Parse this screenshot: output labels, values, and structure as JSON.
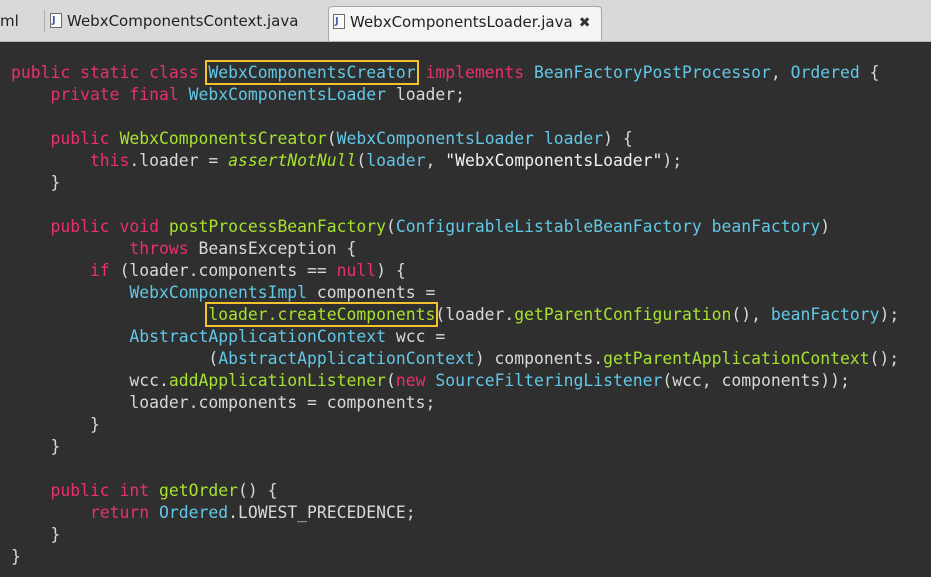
{
  "tabs": [
    {
      "label": "ml",
      "active": false
    },
    {
      "label": "WebxComponentsContext.java",
      "active": false
    },
    {
      "label": "WebxComponentsLoader.java",
      "active": true,
      "close": "✖"
    }
  ],
  "code": {
    "l1": {
      "a": "public static class ",
      "b": "WebxComponentsCreator",
      "c": " implements ",
      "d": "BeanFactoryPostProcessor",
      "e": ", ",
      "f": "Ordered",
      "g": " {"
    },
    "l2": {
      "a": "    private final ",
      "b": "WebxComponentsLoader",
      "c": " loader;"
    },
    "l4": {
      "a": "    public ",
      "b": "WebxComponentsCreator",
      "c": "(",
      "d": "WebxComponentsLoader",
      "e": " loader",
      "f": ") {"
    },
    "l5": {
      "a": "        this",
      "b": ".loader = ",
      "c": "assertNotNull",
      "d": "(",
      "e": "loader",
      "f": ", ",
      "g": "\"WebxComponentsLoader\"",
      "h": ");"
    },
    "l6": {
      "a": "    }"
    },
    "l8": {
      "a": "    public void ",
      "b": "postProcessBeanFactory",
      "c": "(",
      "d": "ConfigurableListableBeanFactory",
      "e": " beanFactory",
      "f": ")"
    },
    "l9": {
      "a": "            throws ",
      "b": "BeansException {"
    },
    "l10": {
      "a": "        if ",
      "b": "(loader.components == ",
      "c": "null",
      "d": ") {"
    },
    "l11": {
      "a": "            ",
      "b": "WebxComponentsImpl",
      "c": " components ="
    },
    "l12": {
      "a": "                    ",
      "b": "loader.createComponents",
      "c": "(loader.",
      "d": "getParentConfiguration",
      "e": "(), ",
      "f": "beanFactory",
      "g": ");"
    },
    "l13": {
      "a": "            ",
      "b": "AbstractApplicationContext",
      "c": " wcc ="
    },
    "l14": {
      "a": "                    (",
      "b": "AbstractApplicationContext",
      "c": ") components.",
      "d": "getParentApplicationContext",
      "e": "();"
    },
    "l15": {
      "a": "            wcc.",
      "b": "addApplicationListener",
      "c": "(",
      "d": "new ",
      "e": "SourceFilteringListener",
      "f": "(wcc, components));"
    },
    "l16": {
      "a": "            loader.components = components;"
    },
    "l17": {
      "a": "        }"
    },
    "l18": {
      "a": "    }"
    },
    "l20": {
      "a": "    public int ",
      "b": "getOrder",
      "c": "() {"
    },
    "l21": {
      "a": "        return ",
      "b": "Ordered",
      "c": ".LOWEST_PRECEDENCE;"
    },
    "l22": {
      "a": "    }"
    },
    "l23": {
      "a": "}"
    }
  },
  "colors": {
    "keyword": "#e8306d",
    "type": "#62c7e6",
    "method": "#a6e22e",
    "highlight_box": "#f2c12e",
    "background": "#2f2f2f"
  }
}
